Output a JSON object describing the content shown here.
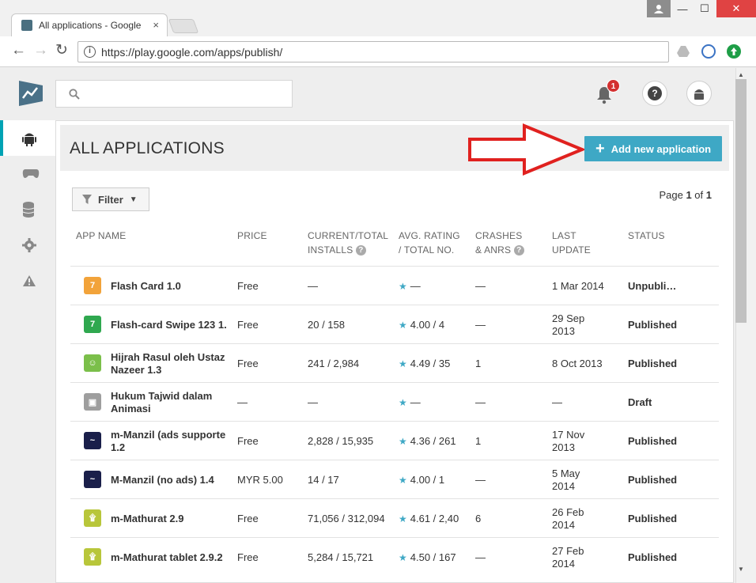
{
  "browser": {
    "tab_title": "All applications - Google",
    "tab_close": "×",
    "url": "https://play.google.com/apps/publish/",
    "window_buttons": {
      "minimize": "—",
      "maximize": "☐",
      "close": "✕"
    }
  },
  "topbar": {
    "search_placeholder": "",
    "notification_count": "1",
    "help_label": "?"
  },
  "sidebar": {
    "items": [
      {
        "icon": "android-icon",
        "active": true
      },
      {
        "icon": "gamepad-icon",
        "active": false
      },
      {
        "icon": "database-icon",
        "active": false
      },
      {
        "icon": "gear-icon",
        "active": false
      },
      {
        "icon": "warning-icon",
        "active": false
      }
    ]
  },
  "main": {
    "title": "ALL APPLICATIONS",
    "add_button": "Add new application",
    "filter_label": "Filter",
    "pager": {
      "prefix": "Page ",
      "current": "1",
      "of": " of ",
      "total": "1"
    }
  },
  "table": {
    "headers": {
      "app_name": "APP NAME",
      "price": "PRICE",
      "installs_1": "CURRENT/TOTAL",
      "installs_2": "INSTALLS",
      "rating_1": "AVG. RATING",
      "rating_2": "/ TOTAL NO.",
      "crashes_1": "CRASHES",
      "crashes_2": "& ANRS",
      "update_1": "LAST",
      "update_2": "UPDATE",
      "status": "STATUS"
    },
    "rows": [
      {
        "name1": "Flash Card 1.0",
        "name2": "",
        "price": "Free",
        "installs": "—",
        "rating": "—",
        "crashes": "—",
        "update1": "1 Mar 2014",
        "update2": "",
        "status": "Unpubli…",
        "icon_color": "#f2a33a",
        "icon_text": "7"
      },
      {
        "name1": "Flash-card Swipe 123 1.",
        "name2": "",
        "price": "Free",
        "installs": "20  /  158",
        "rating": "4.00  /  4",
        "crashes": "—",
        "update1": "29 Sep",
        "update2": "2013",
        "status": "Published",
        "icon_color": "#2fa84f",
        "icon_text": "7"
      },
      {
        "name1": "Hijrah Rasul oleh Ustaz",
        "name2": "Nazeer 1.3",
        "price": "Free",
        "installs": "241  /  2,984",
        "rating": "4.49  /  35",
        "crashes": "1",
        "update1": "8 Oct 2013",
        "update2": "",
        "status": "Published",
        "icon_color": "#7bbf4a",
        "icon_text": "☺"
      },
      {
        "name1": "Hukum Tajwid dalam",
        "name2": "Animasi",
        "price": "—",
        "installs": "—",
        "rating": "—",
        "crashes": "—",
        "update1": "—",
        "update2": "",
        "status": "Draft",
        "icon_color": "#9e9e9e",
        "icon_text": "▣"
      },
      {
        "name1": "m-Manzil (ads supporte",
        "name2": "1.2",
        "price": "Free",
        "installs": "2,828  /  15,935",
        "rating": "4.36  /  261",
        "crashes": "1",
        "update1": "17 Nov",
        "update2": "2013",
        "status": "Published",
        "icon_color": "#1a1f4a",
        "icon_text": "~"
      },
      {
        "name1": "M-Manzil (no ads) 1.4",
        "name2": "",
        "price": "MYR 5.00",
        "installs": "14  /  17",
        "rating": "4.00  /  1",
        "crashes": "—",
        "update1": "5 May",
        "update2": "2014",
        "status": "Published",
        "icon_color": "#1a1f4a",
        "icon_text": "~"
      },
      {
        "name1": "m-Mathurat 2.9",
        "name2": "",
        "price": "Free",
        "installs": "71,056  /  312,094",
        "rating": "4.61  /  2,40",
        "crashes": "6",
        "update1": "26 Feb",
        "update2": "2014",
        "status": "Published",
        "icon_color": "#b8c63a",
        "icon_text": "۩"
      },
      {
        "name1": "m-Mathurat tablet 2.9.2",
        "name2": "",
        "price": "Free",
        "installs": "5,284  /  15,721",
        "rating": "4.50  /  167",
        "crashes": "—",
        "update1": "27 Feb",
        "update2": "2014",
        "status": "Published",
        "icon_color": "#b8c63a",
        "icon_text": "۩"
      }
    ]
  }
}
